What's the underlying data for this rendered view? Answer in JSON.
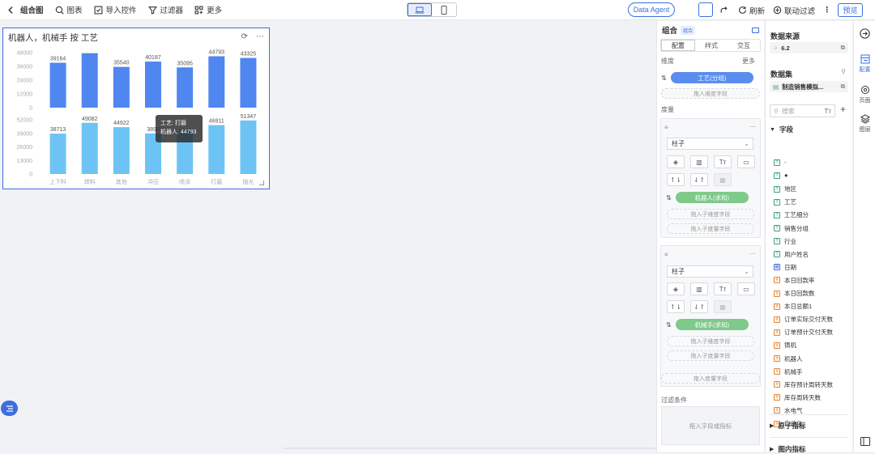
{
  "toolbar": {
    "back": "<",
    "title": "组合图",
    "chart": "图表",
    "import": "导入控件",
    "filter": "过滤器",
    "more": "更多",
    "agent": "Data Agent",
    "refresh": "刷新",
    "link_filter": "联动过滤",
    "preview": "预览"
  },
  "chart_card": {
    "title": "机器人，机械手 按 工艺",
    "tooltip_line1": "工艺: 打磨",
    "tooltip_line2": "机器人: 44793"
  },
  "chart_data": {
    "type": "bar",
    "categories": [
      "上下料",
      "焊料",
      "其他",
      "冲压",
      "喷涂",
      "打磨",
      "抛光"
    ],
    "series": [
      {
        "values": [
          39164,
          47500,
          35540,
          40187,
          35095,
          44793,
          43325
        ],
        "color": "#4f86f0",
        "ylim": [
          0,
          48000
        ],
        "yticks": [
          0,
          12000,
          24000,
          36000,
          48000
        ],
        "ytick_labels": [
          "0",
          "12000",
          "24000",
          "36000",
          "48000"
        ],
        "data_labels": [
          "39164",
          "",
          "35540",
          "40187",
          "35095",
          "44793",
          "43325"
        ]
      },
      {
        "values": [
          38713,
          49082,
          44922,
          38906,
          43000,
          46911,
          51347
        ],
        "color": "#6dc4f4",
        "ylim": [
          0,
          52000
        ],
        "yticks": [
          0,
          13000,
          26000,
          39000,
          52000
        ],
        "ytick_labels": [
          "0",
          "13000",
          "26000",
          "39000",
          "52000"
        ],
        "data_labels": [
          "38713",
          "49082",
          "44922",
          "3890",
          "",
          "46911",
          "51347"
        ]
      }
    ],
    "legend": "none",
    "grid": false
  },
  "config": {
    "title": "组合",
    "badge": "组合",
    "tabs": [
      "配置",
      "样式",
      "交互"
    ],
    "dim_label": "维度",
    "more": "更多",
    "dim_pill": "工艺(分组)",
    "dim_drop": "拖入维度字段",
    "measure_label": "度量",
    "box1": {
      "type": "柱子",
      "pill": "机器人(求和)",
      "drop1": "拖入子维度字段",
      "drop2": "拖入子度量字段"
    },
    "box2": {
      "type": "柱子",
      "pill": "机械手(求和)",
      "drop1": "拖入子维度字段",
      "drop2": "拖入子度量字段"
    },
    "measure_drop": "拖入度量字段",
    "filter_label": "过滤条件",
    "filter_drop": "拖入字段或指标",
    "colors": {
      "dim_pill": "#5b8def",
      "measure_pill": "#7fc98a"
    }
  },
  "dataset": {
    "source_label": "数据来源",
    "source_value": "6.2",
    "set_label": "数据集",
    "set_value": "制造销售模拟...",
    "search_placeholder": "搜索",
    "fields_label": "字段",
    "fields": [
      {
        "name": "-",
        "kind": "t"
      },
      {
        "name": "●",
        "kind": "t"
      },
      {
        "name": "地区",
        "kind": "t"
      },
      {
        "name": "工艺",
        "kind": "t"
      },
      {
        "name": "工艺细分",
        "kind": "t"
      },
      {
        "name": "销售分组",
        "kind": "t"
      },
      {
        "name": "行业",
        "kind": "t"
      },
      {
        "name": "用户姓名",
        "kind": "t"
      },
      {
        "name": "日期",
        "kind": "d"
      },
      {
        "name": "本日回款率",
        "kind": "n"
      },
      {
        "name": "本日回款数",
        "kind": "n"
      },
      {
        "name": "本日总额1",
        "kind": "n"
      },
      {
        "name": "订单实际交付天数",
        "kind": "n"
      },
      {
        "name": "订单预计交付天数",
        "kind": "n"
      },
      {
        "name": "铸机",
        "kind": "n"
      },
      {
        "name": "机器人",
        "kind": "n"
      },
      {
        "name": "机械手",
        "kind": "n"
      },
      {
        "name": "库存预计周转天数",
        "kind": "n"
      },
      {
        "name": "库存周转天数",
        "kind": "n"
      },
      {
        "name": "水电气",
        "kind": "n"
      },
      {
        "name": "自动化",
        "kind": "n"
      }
    ],
    "atom_label": "原子指标",
    "derived_label": "图内指标"
  },
  "rail": {
    "config": "配置",
    "page": "页面",
    "layer": "图层"
  }
}
